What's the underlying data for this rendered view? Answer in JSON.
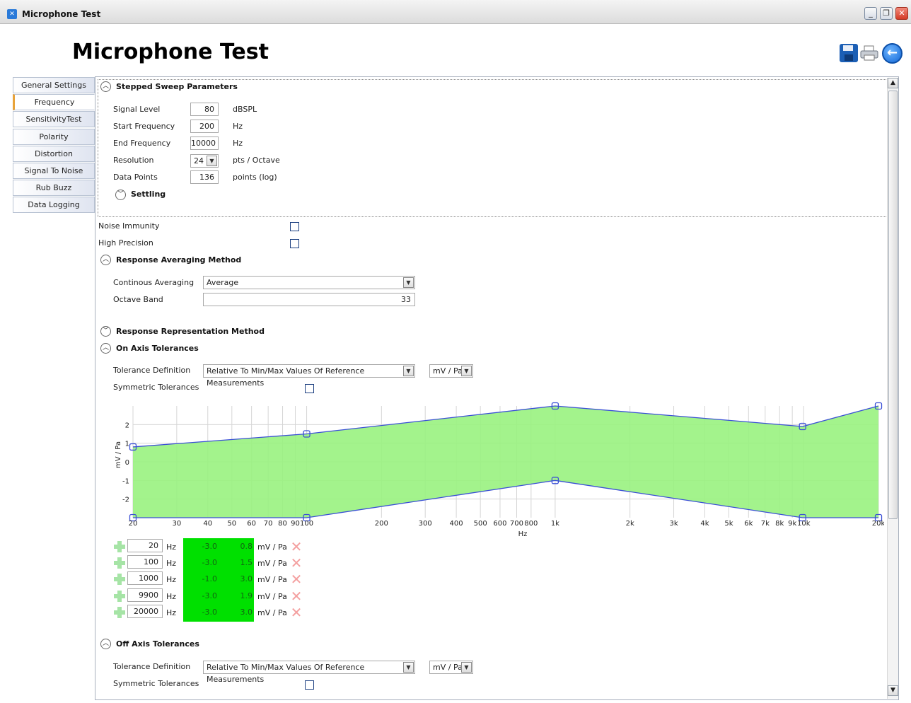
{
  "window": {
    "title": "Microphone Test",
    "min_label": "_",
    "restore_label": "❐",
    "close_label": "✕"
  },
  "page_title": "Microphone Test",
  "sidebar": {
    "items": [
      {
        "label": "General Settings",
        "active": false
      },
      {
        "label": "Frequency Response",
        "active": true
      },
      {
        "label": "SensitivityTest",
        "active": false
      },
      {
        "label": "Polarity",
        "active": false
      },
      {
        "label": "Distortion",
        "active": false
      },
      {
        "label": "Signal To Noise Ratio",
        "active": false
      },
      {
        "label": "Rub Buzz",
        "active": false
      },
      {
        "label": "Data Logging",
        "active": false
      }
    ]
  },
  "stepped_sweep": {
    "header": "Stepped Sweep Parameters",
    "signal_level": {
      "label": "Signal Level",
      "value": "80",
      "unit": "dBSPL"
    },
    "start_frequency": {
      "label": "Start Frequency",
      "value": "200",
      "unit": "Hz"
    },
    "end_frequency": {
      "label": "End Frequency",
      "value": "10000",
      "unit": "Hz"
    },
    "resolution": {
      "label": "Resolution",
      "value": "24",
      "unit": "pts / Octave"
    },
    "data_points": {
      "label": "Data Points",
      "value": "136",
      "unit": "points (log)"
    },
    "settling": "Settling"
  },
  "noise_immunity": {
    "label": "Noise Immunity",
    "checked": false
  },
  "high_precision": {
    "label": "High Precision",
    "checked": false
  },
  "averaging": {
    "header": "Response Averaging Method",
    "continuous_label": "Continous Averaging",
    "continuous_value": "Average",
    "octave_label": "Octave Band",
    "octave_value": "33"
  },
  "representation_header": "Response Representation Method",
  "on_axis": {
    "header": "On Axis Tolerances",
    "tolerance_label": "Tolerance Definition",
    "tolerance_value": "Relative To Min/Max Values Of Reference Measurements",
    "unit_value": "mV / Pa",
    "symmetric_label": "Symmetric Tolerances",
    "rows": [
      {
        "freq": "20",
        "freq_unit": "Hz",
        "low": "-3.0",
        "high": "0.8",
        "unit": "mV / Pa"
      },
      {
        "freq": "100",
        "freq_unit": "Hz",
        "low": "-3.0",
        "high": "1.5",
        "unit": "mV / Pa"
      },
      {
        "freq": "1000",
        "freq_unit": "Hz",
        "low": "-1.0",
        "high": "3.0",
        "unit": "mV / Pa"
      },
      {
        "freq": "9900",
        "freq_unit": "Hz",
        "low": "-3.0",
        "high": "1.9",
        "unit": "mV / Pa"
      },
      {
        "freq": "20000",
        "freq_unit": "Hz",
        "low": "-3.0",
        "high": "3.0",
        "unit": "mV / Pa"
      }
    ]
  },
  "off_axis": {
    "header": "Off Axis Tolerances",
    "tolerance_label": "Tolerance Definition",
    "tolerance_value": "Relative To Min/Max Values Of Reference Measurements",
    "unit_value": "mV / Pa",
    "symmetric_label": "Symmetric Tolerances"
  },
  "chart_data": {
    "type": "area",
    "xlabel": "Hz",
    "ylabel": "mV / Pa",
    "x_scale": "log",
    "xlim": [
      20,
      20000
    ],
    "ylim": [
      -3,
      3
    ],
    "x_ticks": [
      20,
      30,
      40,
      50,
      60,
      70,
      80,
      90,
      100,
      200,
      300,
      400,
      500,
      600,
      700,
      800,
      1000,
      2000,
      3000,
      4000,
      5000,
      6000,
      7000,
      8000,
      9000,
      10000,
      20000
    ],
    "x_tick_labels": [
      "20",
      "30",
      "40",
      "50",
      "60",
      "70",
      "80",
      "90",
      "100",
      "200",
      "300",
      "400",
      "500",
      "600",
      "700",
      "800",
      "1k",
      "2k",
      "3k",
      "4k",
      "5k",
      "6k",
      "7k",
      "8k",
      "9k",
      "10k",
      "20k"
    ],
    "y_ticks": [
      2,
      1,
      0,
      -1,
      -2
    ],
    "y_tick_labels": [
      "2",
      "1",
      "0",
      "-1",
      "-2"
    ],
    "series": [
      {
        "x": [
          20,
          100,
          1000,
          9900,
          20000
        ],
        "values": [
          0.8,
          1.5,
          3.0,
          1.9,
          3.0
        ]
      },
      {
        "x": [
          20,
          100,
          1000,
          9900,
          20000
        ],
        "values": [
          -3.0,
          -3.0,
          -1.0,
          -3.0,
          -3.0
        ]
      }
    ],
    "fill_color": "#99f280",
    "line_color": "#3a4fd6",
    "grid": true
  }
}
